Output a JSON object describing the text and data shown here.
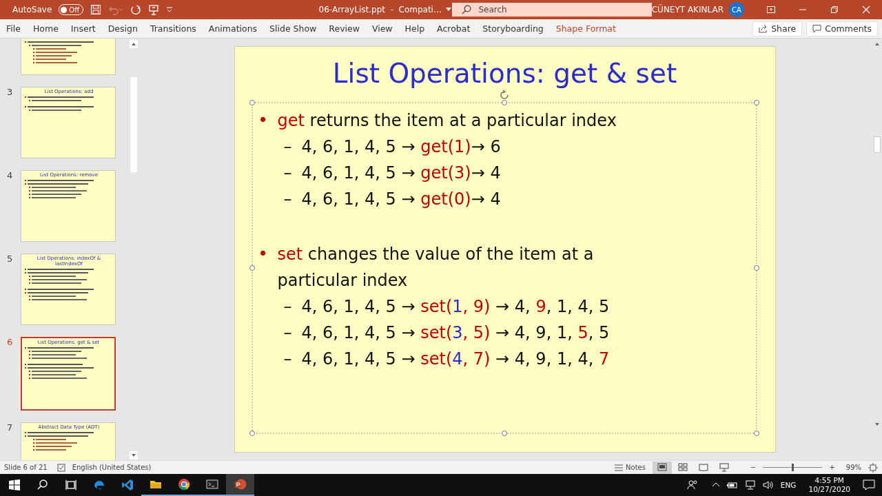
{
  "titlebar": {
    "autosave": {
      "label": "AutoSave",
      "state": "Off",
      "on": false
    },
    "undo": {
      "disabled": true
    },
    "doc_title": "06-ArrayList.ppt  -  Compati…",
    "search": {
      "placeholder": "Search"
    },
    "user": "CÜNEYT AKINLAR",
    "avatar": "CA"
  },
  "ribbon": {
    "tabs": [
      {
        "label": "File",
        "kind": "normal"
      },
      {
        "label": "Home",
        "kind": "normal"
      },
      {
        "label": "Insert",
        "kind": "normal"
      },
      {
        "label": "Design",
        "kind": "normal"
      },
      {
        "label": "Transitions",
        "kind": "normal"
      },
      {
        "label": "Animations",
        "kind": "normal"
      },
      {
        "label": "Slide Show",
        "kind": "normal"
      },
      {
        "label": "Review",
        "kind": "normal"
      },
      {
        "label": "View",
        "kind": "normal"
      },
      {
        "label": "Help",
        "kind": "normal"
      },
      {
        "label": "Acrobat",
        "kind": "normal"
      },
      {
        "label": "Storyboarding",
        "kind": "normal"
      },
      {
        "label": "Shape Format",
        "kind": "contextual"
      }
    ],
    "share": "Share",
    "comments": "Comments"
  },
  "thumbnails": [
    {
      "selected": false,
      "partial": true,
      "lines": [
        {
          "kind": "bullet"
        },
        {
          "kind": "sub"
        },
        {
          "kind": "subsub"
        },
        {
          "kind": "subsub"
        },
        {
          "kind": "subsub"
        },
        {
          "kind": "subsub"
        },
        {
          "kind": "subsub"
        }
      ]
    },
    {
      "number": "3",
      "selected": false,
      "title": "List Operations: add",
      "lines": [
        {
          "kind": "bullet"
        },
        {
          "kind": "sub"
        },
        {
          "kind": "gap"
        },
        {
          "kind": "bullet"
        },
        {
          "kind": "sub"
        }
      ]
    },
    {
      "number": "4",
      "selected": false,
      "title": "List Operations: remove",
      "lines": [
        {
          "kind": "bullet"
        },
        {
          "kind": "bullet"
        },
        {
          "kind": "sub"
        },
        {
          "kind": "sub"
        },
        {
          "kind": "sub"
        },
        {
          "kind": "sub"
        }
      ]
    },
    {
      "number": "5",
      "selected": false,
      "title": "List Operations: indexOf & lastIndexOf",
      "lines": [
        {
          "kind": "bullet"
        },
        {
          "kind": "bullet"
        },
        {
          "kind": "sub"
        },
        {
          "kind": "sub"
        },
        {
          "kind": "sub"
        },
        {
          "kind": "gap"
        },
        {
          "kind": "bullet"
        },
        {
          "kind": "bullet"
        },
        {
          "kind": "sub"
        },
        {
          "kind": "sub"
        }
      ]
    },
    {
      "number": "6",
      "selected": true,
      "title": "List Operations: get & set",
      "lines": [
        {
          "kind": "bullet"
        },
        {
          "kind": "sub"
        },
        {
          "kind": "sub"
        },
        {
          "kind": "sub"
        },
        {
          "kind": "gap"
        },
        {
          "kind": "bullet"
        },
        {
          "kind": "bullet"
        },
        {
          "kind": "sub"
        },
        {
          "kind": "sub"
        },
        {
          "kind": "sub"
        }
      ]
    },
    {
      "number": "7",
      "selected": false,
      "title": "Abstract Data Type (ADT)",
      "lines": [
        {
          "kind": "bullet"
        },
        {
          "kind": "bullet"
        },
        {
          "kind": "subsub"
        },
        {
          "kind": "subsub"
        },
        {
          "kind": "subsub"
        },
        {
          "kind": "subsub"
        }
      ]
    }
  ],
  "slide": {
    "title": "List Operations: get & set",
    "lines": [
      {
        "kind": "bullet",
        "marker": "•",
        "segments": [
          {
            "kind": "keyword",
            "text": "get"
          },
          {
            "kind": "plain",
            "text": " returns the item at a particular index"
          }
        ]
      },
      {
        "kind": "sub",
        "marker": "–",
        "segments": [
          {
            "kind": "plain",
            "text": "4, 6, 1, 4, 5 → "
          },
          {
            "kind": "keyword",
            "text": "get(1)"
          },
          {
            "kind": "plain",
            "text": "→ 6"
          }
        ]
      },
      {
        "kind": "sub",
        "marker": "–",
        "segments": [
          {
            "kind": "plain",
            "text": "4, 6, 1, 4, 5 → "
          },
          {
            "kind": "keyword",
            "text": "get(3)"
          },
          {
            "kind": "plain",
            "text": "→ 4"
          }
        ]
      },
      {
        "kind": "sub",
        "marker": "–",
        "segments": [
          {
            "kind": "plain",
            "text": "4, 6, 1, 4, 5 → "
          },
          {
            "kind": "keyword",
            "text": "get(0)"
          },
          {
            "kind": "plain",
            "text": "→ 4"
          }
        ]
      },
      {
        "kind": "bullet",
        "marker": "•",
        "segments": [
          {
            "kind": "keyword",
            "text": "set"
          },
          {
            "kind": "plain",
            "text": " changes the value of the item at a particular index"
          }
        ]
      },
      {
        "kind": "sub",
        "marker": "–",
        "segments": [
          {
            "kind": "plain",
            "text": "4, 6, 1, 4, 5 → "
          },
          {
            "kind": "keyword",
            "text": "set("
          },
          {
            "kind": "index",
            "text": "1"
          },
          {
            "kind": "keyword",
            "text": ", 9)"
          },
          {
            "kind": "plain",
            "text": " → 4, "
          },
          {
            "kind": "keyword",
            "text": "9"
          },
          {
            "kind": "plain",
            "text": ", 1, 4, 5"
          }
        ]
      },
      {
        "kind": "sub",
        "marker": "–",
        "segments": [
          {
            "kind": "plain",
            "text": "4, 6, 1, 4, 5 → "
          },
          {
            "kind": "keyword",
            "text": "set("
          },
          {
            "kind": "index",
            "text": "3"
          },
          {
            "kind": "keyword",
            "text": ", 5)"
          },
          {
            "kind": "plain",
            "text": " → 4, 9, 1, "
          },
          {
            "kind": "keyword",
            "text": "5"
          },
          {
            "kind": "plain",
            "text": ", 5"
          }
        ]
      },
      {
        "kind": "sub",
        "marker": "–",
        "segments": [
          {
            "kind": "plain",
            "text": "4, 6, 1, 4, 5 → "
          },
          {
            "kind": "keyword",
            "text": "set("
          },
          {
            "kind": "index",
            "text": "4"
          },
          {
            "kind": "keyword",
            "text": ", 7)"
          },
          {
            "kind": "plain",
            "text": " → 4, 9, 1, 4, "
          },
          {
            "kind": "keyword",
            "text": "7"
          }
        ]
      }
    ]
  },
  "status_bar": {
    "slide_info": "Slide 6 of 21",
    "language": "English (United States)",
    "notes": "Notes",
    "zoom": {
      "minus": "−",
      "plus": "+",
      "level": 0.5,
      "reading": "99%"
    }
  },
  "taskbar": {
    "apps": [
      {
        "kind": "edge",
        "running": false,
        "active": false
      },
      {
        "kind": "code",
        "running": false,
        "active": false
      },
      {
        "kind": "folder",
        "running": true,
        "active": false
      },
      {
        "kind": "chrome",
        "running": true,
        "active": false
      },
      {
        "kind": "terminal",
        "running": true,
        "active": false
      },
      {
        "kind": "powerpoint",
        "running": true,
        "active": true
      }
    ],
    "language": "ENG",
    "time": "4:55 PM",
    "date": "10/27/2020"
  }
}
